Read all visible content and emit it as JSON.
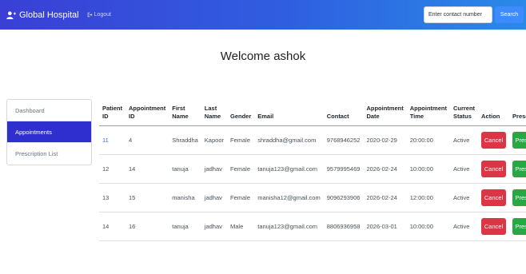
{
  "navbar": {
    "brand": "Global Hospital",
    "logout": "Logout",
    "search_placeholder": "Enter contact number",
    "search_button": "Search"
  },
  "welcome": "Welcome  ashok",
  "sidebar": {
    "items": [
      {
        "label": "Dashboard"
      },
      {
        "label": "Appointments"
      },
      {
        "label": "Prescription List"
      }
    ],
    "active": "Appointments"
  },
  "table": {
    "headers": [
      {
        "l1": "Patient",
        "l2": "ID"
      },
      {
        "l1": "Appointment",
        "l2": "ID"
      },
      {
        "l1": "First",
        "l2": "Name"
      },
      {
        "l1": "Last",
        "l2": "Name"
      },
      {
        "l1": "",
        "l2": "Gender"
      },
      {
        "l1": "",
        "l2": "Email"
      },
      {
        "l1": "",
        "l2": "Contact"
      },
      {
        "l1": "Appointment",
        "l2": "Date"
      },
      {
        "l1": "Appointment",
        "l2": "Time"
      },
      {
        "l1": "Current",
        "l2": "Status"
      },
      {
        "l1": "",
        "l2": "Action"
      },
      {
        "l1": "",
        "l2": "Prescribe"
      }
    ],
    "rows": [
      {
        "patient_id": "11",
        "appointment_id": "4",
        "first_name": "Shraddha",
        "last_name": "Kapoor",
        "gender": "Female",
        "email": "shraddha@gmail.com",
        "contact": "9768946252",
        "date": "2020-02-29",
        "time": "20:00:00",
        "status": "Active",
        "action": "Cancel",
        "prescribe": "Prescibe"
      },
      {
        "patient_id": "12",
        "appointment_id": "14",
        "first_name": "tanuja",
        "last_name": "jadhav",
        "gender": "Female",
        "email": "tanuja123@gmail.com",
        "contact": "9579995469",
        "date": "2026-02-24",
        "time": "10:00:00",
        "status": "Active",
        "action": "Cancel",
        "prescribe": "Prescibe"
      },
      {
        "patient_id": "13",
        "appointment_id": "15",
        "first_name": "manisha",
        "last_name": "jadhav",
        "gender": "Female",
        "email": "manisha12@gmail.com",
        "contact": "9096293906",
        "date": "2026-02-24",
        "time": "12:00:00",
        "status": "Active",
        "action": "Cancel",
        "prescribe": "Prescibe"
      },
      {
        "patient_id": "14",
        "appointment_id": "16",
        "first_name": "tanuja",
        "last_name": "jadhav",
        "gender": "Male",
        "email": "tanuja123@gmail.com",
        "contact": "8806936958",
        "date": "2026-03-01",
        "time": "10:00:00",
        "status": "Active",
        "action": "Cancel",
        "prescribe": "Prescibe"
      }
    ]
  },
  "colors": {
    "navbar_start": "#3a3fd6",
    "navbar_end": "#2a8ae8",
    "sidebar_active": "#2f2fd0",
    "cancel": "#dc3545",
    "prescribe": "#28a745",
    "search_button": "#3d8bfd"
  },
  "icons": {
    "brand": "user-plus-icon",
    "logout": "sign-out-icon"
  }
}
